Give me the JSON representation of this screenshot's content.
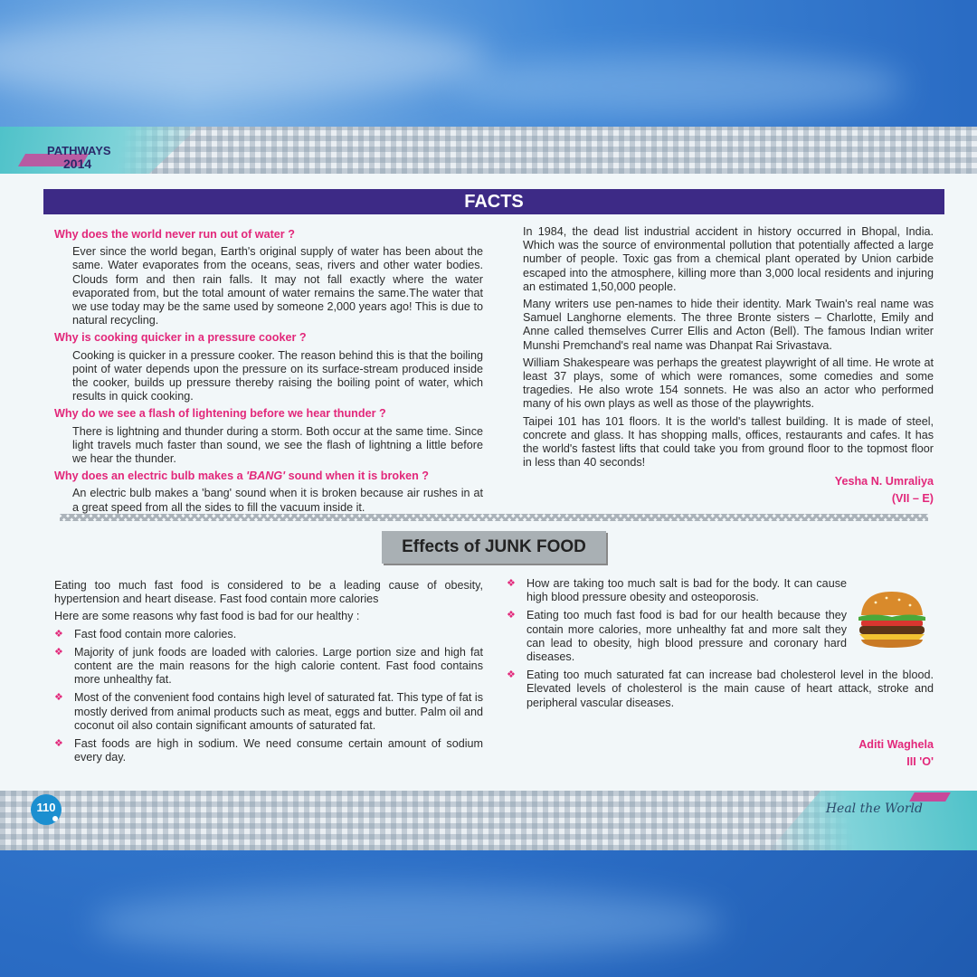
{
  "header": {
    "brand": "PATHWAYS",
    "year": "2014"
  },
  "footer": {
    "page_number": "110",
    "tagline": "Heal the World"
  },
  "facts": {
    "heading": "FACTS",
    "qa": [
      {
        "q": "Why does the world never run out of water ?",
        "a": "Ever since the world began, Earth's original supply of water has been about the same. Water evaporates from the oceans, seas, rivers and other water bodies. Clouds form and then rain falls. It may not fall exactly where the water evaporated from, but the total amount of water remains the same.The water that we use today may be the same used by someone 2,000 years ago! This is due to natural recycling."
      },
      {
        "q": "Why is cooking quicker in a pressure cooker ?",
        "a": "Cooking is quicker in a pressure cooker. The reason behind this is that the boiling point of water depends upon the pressure on its surface-stream produced inside the cooker, builds up pressure thereby raising the boiling point of water, which results in quick cooking."
      },
      {
        "q": "Why do we see a flash of lightening before we hear thunder ?",
        "a": "There is lightning and thunder during a storm. Both occur at the same time. Since light travels much faster than sound, we see the flash of lightning a little before we hear the thunder."
      },
      {
        "q_pre": "Why does an electric bulb makes a ",
        "q_em": "'BANG'",
        "q_post": " sound when it is broken ?",
        "a": "An electric bulb makes a 'bang' sound when it is broken because air rushes in at a great speed from all the sides to fill the vacuum inside it."
      }
    ],
    "right_paras": [
      "In 1984, the dead list industrial accident in history occurred in Bhopal, India. Which was the source of environmental pollution that potentially affected a large number of people. Toxic gas from a chemical plant operated by Union carbide escaped into the atmosphere, killing more than 3,000 local residents and injuring an estimated 1,50,000 people.",
      "Many writers use pen-names to hide their identity. Mark Twain's real name was Samuel Langhorne elements. The three Bronte sisters – Charlotte, Emily and Anne called themselves Currer Ellis and Acton (Bell). The famous Indian writer Munshi Premchand's real name was Dhanpat Rai Srivastava.",
      "William Shakespeare was perhaps the greatest playwright of all time. He wrote at least 37 plays, some of which were romances, some comedies and some tragedies. He also wrote 154 sonnets. He was also an actor who performed many of his own plays as well as those of the playwrights.",
      "Taipei 101 has 101 floors. It is the world's tallest building. It is made of steel, concrete and glass. It has shopping malls, offices, restaurants and cafes. It has the world's fastest lifts that could take you from ground floor to the topmost floor in less than 40 seconds!"
    ],
    "author": "Yesha N. Umraliya",
    "class": "(VII – E)"
  },
  "junk": {
    "heading": "Effects of JUNK FOOD",
    "intro1": "Eating too much fast food is considered to be a leading cause of obesity, hypertension and heart disease. Fast food contain more calories",
    "intro2": "Here are some reasons why fast food is bad for our healthy :",
    "left_bullets": [
      "Fast food contain more calories.",
      "Majority of junk foods are loaded with calories. Large portion size and high fat content are the main reasons for the high calorie content. Fast food contains more unhealthy fat.",
      "Most of the convenient food contains high level of saturated fat. This type of fat is mostly derived from animal products such as meat, eggs and butter. Palm oil and coconut oil also contain significant amounts of saturated fat.",
      "Fast foods are high in sodium. We need consume certain amount of sodium every day."
    ],
    "right_bullets": [
      "How are taking too much salt is bad for the body. It can cause high blood pressure obesity and osteoporosis.",
      "Eating too much fast food is bad for our health because they contain more calories, more unhealthy fat and more salt they can lead to obesity, high blood pressure and coronary hard diseases.",
      "Eating too much saturated fat can increase bad cholesterol level in the blood. Elevated levels of cholesterol is the main cause of heart attack, stroke and peripheral vascular diseases."
    ],
    "author": "Aditi Waghela",
    "class": "III 'O'"
  }
}
